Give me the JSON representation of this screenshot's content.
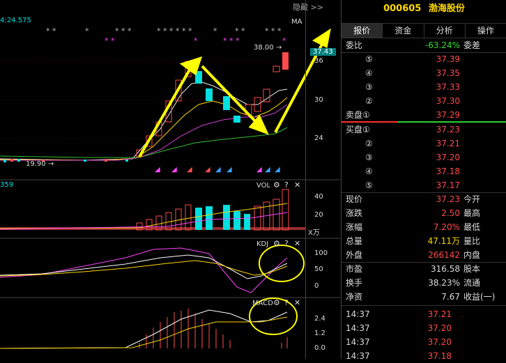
{
  "chart_header": {
    "time": "4:24.575",
    "hidden_btn": "隐藏",
    "hidden_btn_icon": "double-chevron-right-icon",
    "ma_label": "MA",
    "price_marker": "38.00",
    "price_marker_arrow": "→",
    "current_box": "37.43",
    "low_label": "19.90",
    "low_label_arrow": "→"
  },
  "axis_labels": {
    "price": [
      "36",
      "30",
      "24"
    ],
    "vol": [
      "40",
      "20"
    ],
    "vol_unit": "X万",
    "kdj": [
      "100",
      "50",
      "0"
    ],
    "macd": [
      "2.4",
      "1.2",
      "0.0"
    ]
  },
  "panels": {
    "vol": {
      "title": "VOL"
    },
    "kdj": {
      "title": "KDJ"
    },
    "macd": {
      "title": "MACD"
    },
    "vol_left_value": "359"
  },
  "stock": {
    "code": "000605",
    "name": "渤海股份"
  },
  "tabs": [
    "报价",
    "资金",
    "分析",
    "操作"
  ],
  "weibi": {
    "label": "委比",
    "value": "-63.24%",
    "tail": "委差"
  },
  "sell_orders": [
    {
      "label": "⑤",
      "price": "37.39"
    },
    {
      "label": "④",
      "price": "37.35"
    },
    {
      "label": "③",
      "price": "37.33"
    },
    {
      "label": "②",
      "price": "37.30"
    },
    {
      "label": "卖盘①",
      "price": "37.29"
    }
  ],
  "buy_orders": [
    {
      "label": "买盘①",
      "price": "37.23"
    },
    {
      "label": "②",
      "price": "37.21"
    },
    {
      "label": "③",
      "price": "37.20"
    },
    {
      "label": "④",
      "price": "37.18"
    },
    {
      "label": "⑤",
      "price": "37.17"
    }
  ],
  "stats": [
    {
      "label": "现价",
      "value": "37.23",
      "tail": "今开",
      "color": "#ff4b4b"
    },
    {
      "label": "涨跌",
      "value": "2.50",
      "tail": "最高",
      "color": "#ff4b4b"
    },
    {
      "label": "涨幅",
      "value": "7.20%",
      "tail": "最低",
      "color": "#ff4b4b"
    },
    {
      "label": "总量",
      "value": "47.11万",
      "tail": "量比",
      "color": "#ffd800"
    },
    {
      "label": "外盘",
      "value": "266142",
      "tail": "内盘",
      "color": "#ff4b4b"
    },
    {
      "label": "市盈",
      "value": "316.58",
      "tail": "股本",
      "color": "#ddd"
    },
    {
      "label": "换手",
      "value": "38.23%",
      "tail": "流通",
      "color": "#ddd"
    },
    {
      "label": "净资",
      "value": "7.67",
      "tail": "收益(一)",
      "color": "#ddd"
    }
  ],
  "ticks": [
    {
      "time": "14:37",
      "price": "37.21"
    },
    {
      "time": "14:37",
      "price": "37.20"
    },
    {
      "time": "14:37",
      "price": "37.20"
    },
    {
      "time": "14:37",
      "price": "37.18"
    }
  ]
}
